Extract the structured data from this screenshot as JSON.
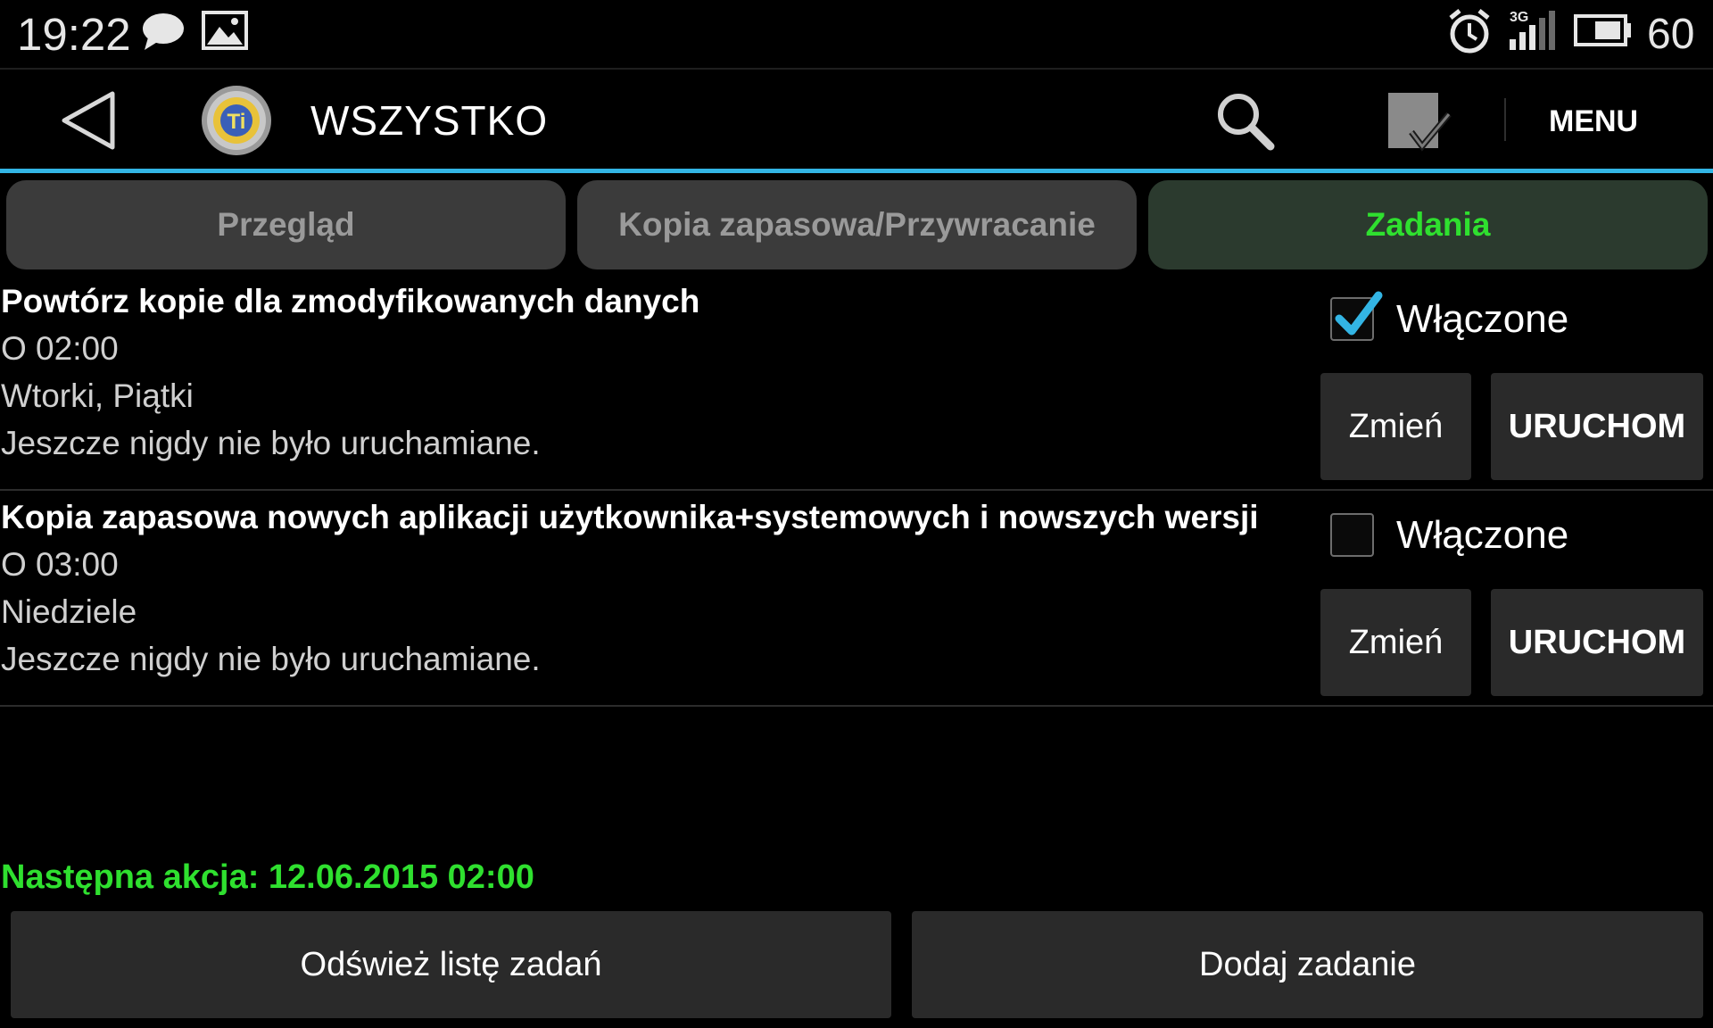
{
  "status_bar": {
    "time": "19:22",
    "battery": "60",
    "icons": [
      "chat-bubble-icon",
      "image-icon",
      "alarm-icon",
      "signal-3g-icon",
      "battery-icon"
    ]
  },
  "action_bar": {
    "title": "WSZYSTKO",
    "menu_label": "MENU",
    "app_icon_letters": "Ti"
  },
  "tabs": [
    {
      "label": "Przegląd",
      "selected": false
    },
    {
      "label": "Kopia zapasowa/Przywracanie",
      "selected": false
    },
    {
      "label": "Zadania",
      "selected": true
    }
  ],
  "tasks": [
    {
      "title": "Powtórz kopie dla zmodyfikowanych danych",
      "time": "O 02:00",
      "days": "Wtorki, Piątki",
      "status": "Jeszcze nigdy nie było uruchamiane.",
      "enabled_label": "Włączone",
      "enabled": true,
      "change_label": "Zmień",
      "run_label": "URUCHOM"
    },
    {
      "title": "Kopia zapasowa nowych aplikacji użytkownika+systemowych i nowszych wersji",
      "time": "O 03:00",
      "days": "Niedziele",
      "status": "Jeszcze nigdy nie było uruchamiane.",
      "enabled_label": "Włączone",
      "enabled": false,
      "change_label": "Zmień",
      "run_label": "URUCHOM"
    }
  ],
  "footer": {
    "next_action": "Następna akcja: 12.06.2015 02:00",
    "refresh_label": "Odśwież listę zadań",
    "add_label": "Dodaj zadanie"
  },
  "colors": {
    "accent_blue": "#33b5e5",
    "accent_green": "#2fe02f",
    "tab_inactive": "#3b3b3b",
    "tab_active": "#2b3a2e",
    "button_bg": "#2a2a2a"
  }
}
